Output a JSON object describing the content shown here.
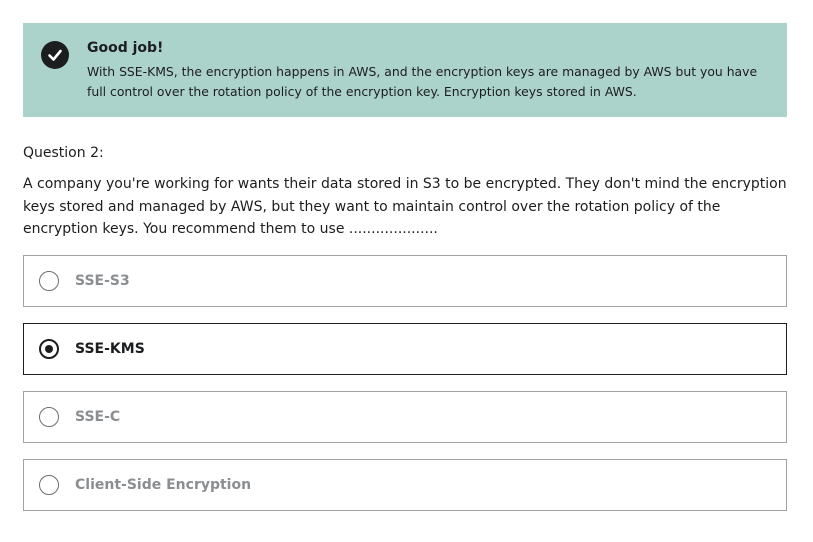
{
  "feedback": {
    "icon": "check-circle-icon",
    "title": "Good job!",
    "text": "With SSE-KMS, the encryption happens in AWS, and the encryption keys are managed by AWS but you have full control over the rotation policy of the encryption key. Encryption keys stored in AWS.",
    "background_color": "#acd2cc"
  },
  "question": {
    "number_label": "Question 2:",
    "text": "A company you're working for wants their data stored in S3 to be encrypted. They don't mind the encryption keys stored and managed by AWS, but they want to maintain control over the rotation policy of the encryption keys. You recommend them to use ...................."
  },
  "options": [
    {
      "label": "SSE-S3",
      "selected": false
    },
    {
      "label": "SSE-KMS",
      "selected": true
    },
    {
      "label": "SSE-C",
      "selected": false
    },
    {
      "label": "Client-Side Encryption",
      "selected": false
    }
  ]
}
